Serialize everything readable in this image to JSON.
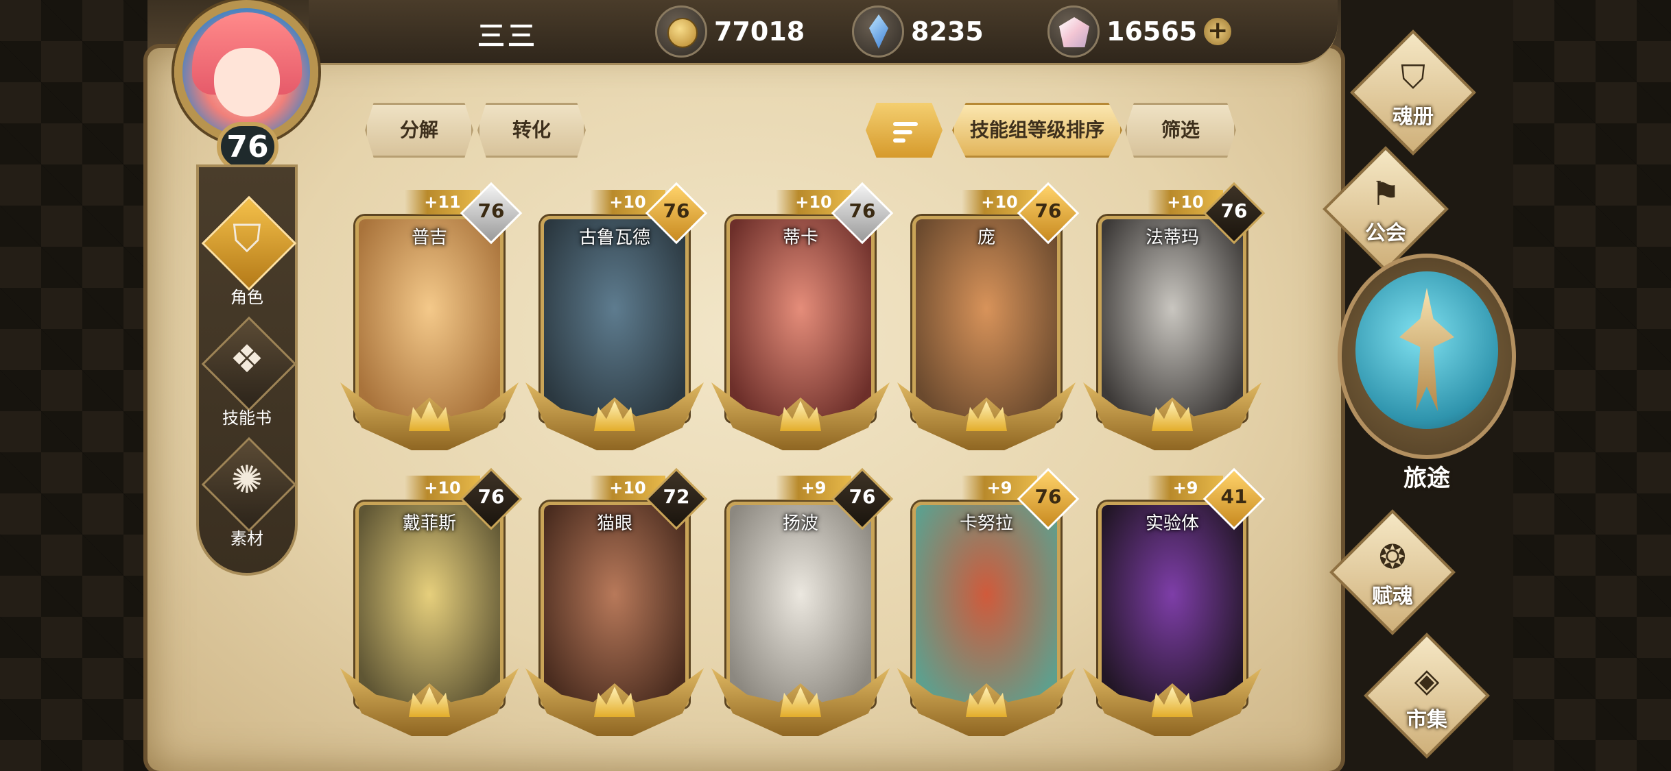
{
  "player": {
    "name": "三三",
    "level": "76"
  },
  "currencies": [
    {
      "icon": "gold-coin-icon",
      "value": "77018"
    },
    {
      "icon": "blue-crystal-icon",
      "value": "8235"
    },
    {
      "icon": "pink-gem-icon",
      "value": "16565"
    }
  ],
  "add_symbol": "+",
  "left_nav": [
    {
      "label": "角色",
      "icon": "helmet-icon",
      "active": true
    },
    {
      "label": "技能书",
      "icon": "skill-book-icon",
      "active": false
    },
    {
      "label": "素材",
      "icon": "material-icon",
      "active": false
    }
  ],
  "toolbar": {
    "decompose": "分解",
    "convert": "转化",
    "sort_mode": "技能组等级排序",
    "filter": "筛选"
  },
  "cards": [
    {
      "name": "普吉",
      "plus": "+11",
      "level": "76",
      "badge": "silver",
      "colors": [
        "#f4c98a",
        "#a9733b"
      ]
    },
    {
      "name": "古鲁瓦德",
      "plus": "+10",
      "level": "76",
      "badge": "gold",
      "colors": [
        "#5e7c8f",
        "#2b3840"
      ]
    },
    {
      "name": "蒂卡",
      "plus": "+10",
      "level": "76",
      "badge": "silver",
      "colors": [
        "#e58d7a",
        "#6d2f2a"
      ]
    },
    {
      "name": "庞",
      "plus": "+10",
      "level": "76",
      "badge": "gold",
      "colors": [
        "#d8935a",
        "#6b4a2e"
      ]
    },
    {
      "name": "法蒂玛",
      "plus": "+10",
      "level": "76",
      "badge": "dark",
      "colors": [
        "#c9c6c0",
        "#3d3a38"
      ]
    },
    {
      "name": "戴菲斯",
      "plus": "+10",
      "level": "76",
      "badge": "dark",
      "colors": [
        "#e6cf7c",
        "#5f5634"
      ]
    },
    {
      "name": "猫眼",
      "plus": "+10",
      "level": "72",
      "badge": "dark",
      "colors": [
        "#b8795a",
        "#4a2c1f"
      ]
    },
    {
      "name": "扬波",
      "plus": "+9",
      "level": "76",
      "badge": "dark",
      "colors": [
        "#ebe7df",
        "#8c8880"
      ]
    },
    {
      "name": "卡努拉",
      "plus": "+9",
      "level": "76",
      "badge": "gold",
      "colors": [
        "#d05a3b",
        "#5f9f8d"
      ]
    },
    {
      "name": "实验体",
      "plus": "+9",
      "level": "41",
      "badge": "gold",
      "colors": [
        "#7e3ea8",
        "#221626"
      ]
    }
  ],
  "right_menu": {
    "soul_book": "魂册",
    "guild": "公会",
    "journey": "旅途",
    "endow_soul": "赋魂",
    "market": "市集"
  }
}
